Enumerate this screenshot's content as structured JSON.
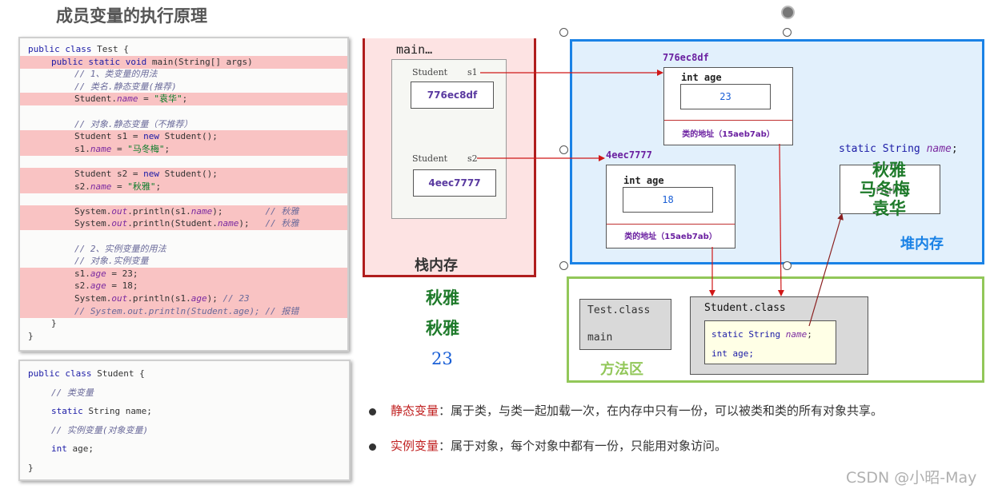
{
  "title": "成员变量的执行原理",
  "test_code": [
    {
      "t": "public class Test {",
      "hl": false,
      "i": 0
    },
    {
      "t": "public static void main(String[] args)",
      "hl": true,
      "i": 1
    },
    {
      "t": "// 1、类变量的用法",
      "hl": false,
      "i": 2,
      "c": true
    },
    {
      "t": "// 类名.静态变量(推荐)",
      "hl": false,
      "i": 2,
      "c": true
    },
    {
      "t": "Student.name = \"袁华\";",
      "hl": true,
      "i": 2
    },
    {
      "t": "",
      "hl": false,
      "i": 2
    },
    {
      "t": "// 对象.静态变量（不推荐）",
      "hl": false,
      "i": 2,
      "c": true
    },
    {
      "t": "Student s1 = new Student();",
      "hl": true,
      "i": 2
    },
    {
      "t": "s1.name = \"马冬梅\";",
      "hl": true,
      "i": 2
    },
    {
      "t": "",
      "hl": false,
      "i": 2
    },
    {
      "t": "Student s2 = new Student();",
      "hl": true,
      "i": 2
    },
    {
      "t": "s2.name = \"秋雅\";",
      "hl": true,
      "i": 2
    },
    {
      "t": "",
      "hl": false,
      "i": 2
    },
    {
      "t": "System.out.println(s1.name);        // 秋雅",
      "hl": true,
      "i": 2
    },
    {
      "t": "System.out.println(Student.name);   // 秋雅",
      "hl": true,
      "i": 2
    },
    {
      "t": "",
      "hl": false,
      "i": 2
    },
    {
      "t": "// 2、实例变量的用法",
      "hl": false,
      "i": 2,
      "c": true
    },
    {
      "t": "// 对象.实例变量",
      "hl": false,
      "i": 2,
      "c": true
    },
    {
      "t": "s1.age = 23;",
      "hl": true,
      "i": 2
    },
    {
      "t": "s2.age = 18;",
      "hl": true,
      "i": 2
    },
    {
      "t": "System.out.println(s1.age); // 23",
      "hl": true,
      "i": 2
    },
    {
      "t": "// System.out.println(Student.age); // 报错",
      "hl": true,
      "i": 2,
      "c": true
    },
    {
      "t": "}",
      "hl": false,
      "i": 1
    },
    {
      "t": "}",
      "hl": false,
      "i": 0
    }
  ],
  "student_code": [
    {
      "t": "public class Student {",
      "i": 0
    },
    {
      "t": "// 类变量",
      "i": 1,
      "c": true
    },
    {
      "t": "static String name;",
      "i": 1
    },
    {
      "t": "// 实例变量(对象变量)",
      "i": 1,
      "c": true
    },
    {
      "t": "int age;",
      "i": 1
    },
    {
      "t": "}",
      "i": 0
    }
  ],
  "stack": {
    "frame_label": "main…",
    "var1_type": "Student",
    "var1_name": "s1",
    "var1_value": "776ec8df",
    "var2_type": "Student",
    "var2_name": "s2",
    "var2_value": "4eec7777",
    "label": "栈内存"
  },
  "output": {
    "line1": "秋雅",
    "line2": "秋雅",
    "line3": "23"
  },
  "heap": {
    "label": "堆内存",
    "obj1": {
      "addr": "776ec8df",
      "field": "int age",
      "value": "23",
      "class_addr": "类的地址（15aeb7ab）"
    },
    "obj2": {
      "addr": "4eec7777",
      "field": "int age",
      "value": "18",
      "class_addr": "类的地址（15aeb7ab）"
    },
    "static_decl_prefix": "static String",
    "static_decl_name": "name",
    "static_decl_suffix": ";",
    "static_values": [
      "秋雅",
      "马冬梅",
      "null",
      "袁华"
    ]
  },
  "method_area": {
    "label": "方法区",
    "test_class": "Test.class",
    "test_main": "main",
    "student_class": "Student.class",
    "student_static_kw": "static String",
    "student_static_name": "name",
    "student_static_end": ";",
    "student_age": "int age;"
  },
  "bullets": [
    {
      "term": "静态变量",
      "text": "：属于类，与类一起加载一次，在内存中只有一份，可以被类和类的所有对象共享。"
    },
    {
      "term": "实例变量",
      "text": "：属于对象，每个对象中都有一份，只能用对象访问。"
    }
  ],
  "watermark": "CSDN @小昭-May",
  "colors": {
    "stack_border": "#b01d1d",
    "heap_border": "#1a82e6",
    "method_border": "#92c759",
    "arrow": "#d01818",
    "static_value_green": "#1e7a2a"
  }
}
